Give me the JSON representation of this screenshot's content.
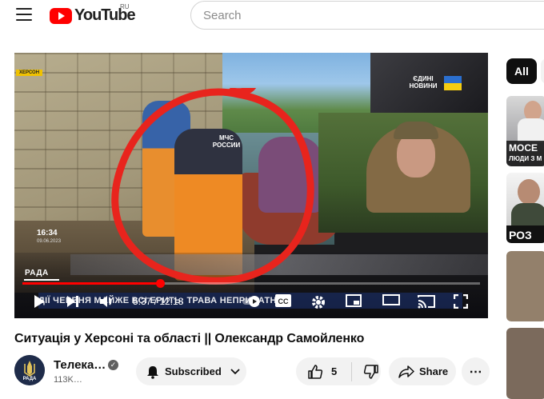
{
  "header": {
    "logo_text": "YouTube",
    "country_code": "RU",
    "search_placeholder": "Search"
  },
  "video": {
    "overlay_location": "ХЕРСОН",
    "overlay_news_badge": "ЄДИНІ НОВИНИ",
    "overlay_clock": "16:34",
    "overlay_date": "09.06.2023",
    "overlay_channel_tag": "РАДА",
    "overlay_vest_text": "МЧС РОССИИ",
    "overlay_ticker": "ДІЇ  ЧЕРВНЯ  МАЙЖЕ ВСІ ЕРИТЬ: ТРАВА НЕПРИДАТНА",
    "time_display": "5:37 / 12:18",
    "progress_fraction": 0.3,
    "accent_color": "#ff0000",
    "annotation_color": "#e8241d"
  },
  "title": "Ситуація у Херсоні та області || Олександр Самойленко",
  "channel": {
    "name": "Телека…",
    "subscribers": "113K…",
    "avatar_text": "РАДА",
    "subscribe_label": "Subscribed"
  },
  "actions": {
    "like_count": "5",
    "share_label": "Share"
  },
  "sidebar": {
    "chip_all": "All",
    "thumb_1_text_line1": "МОСЕ",
    "thumb_1_text_line2": "ЛЮДИ З М",
    "thumb_2_text": "РОЗ"
  },
  "icons": {
    "menu": "hamburger-icon",
    "logo": "youtube-play-icon",
    "play": "play-icon",
    "next": "next-icon",
    "volume": "volume-icon",
    "autoplay": "autoplay-toggle-icon",
    "subtitles": "subtitles-icon",
    "settings": "gear-icon",
    "miniplayer": "miniplayer-icon",
    "theater": "theater-mode-icon",
    "cast": "cast-icon",
    "fullscreen": "fullscreen-icon",
    "bell": "bell-icon",
    "like": "thumbs-up-icon",
    "dislike": "thumbs-down-icon",
    "share": "share-icon",
    "more": "more-horizontal-icon"
  }
}
